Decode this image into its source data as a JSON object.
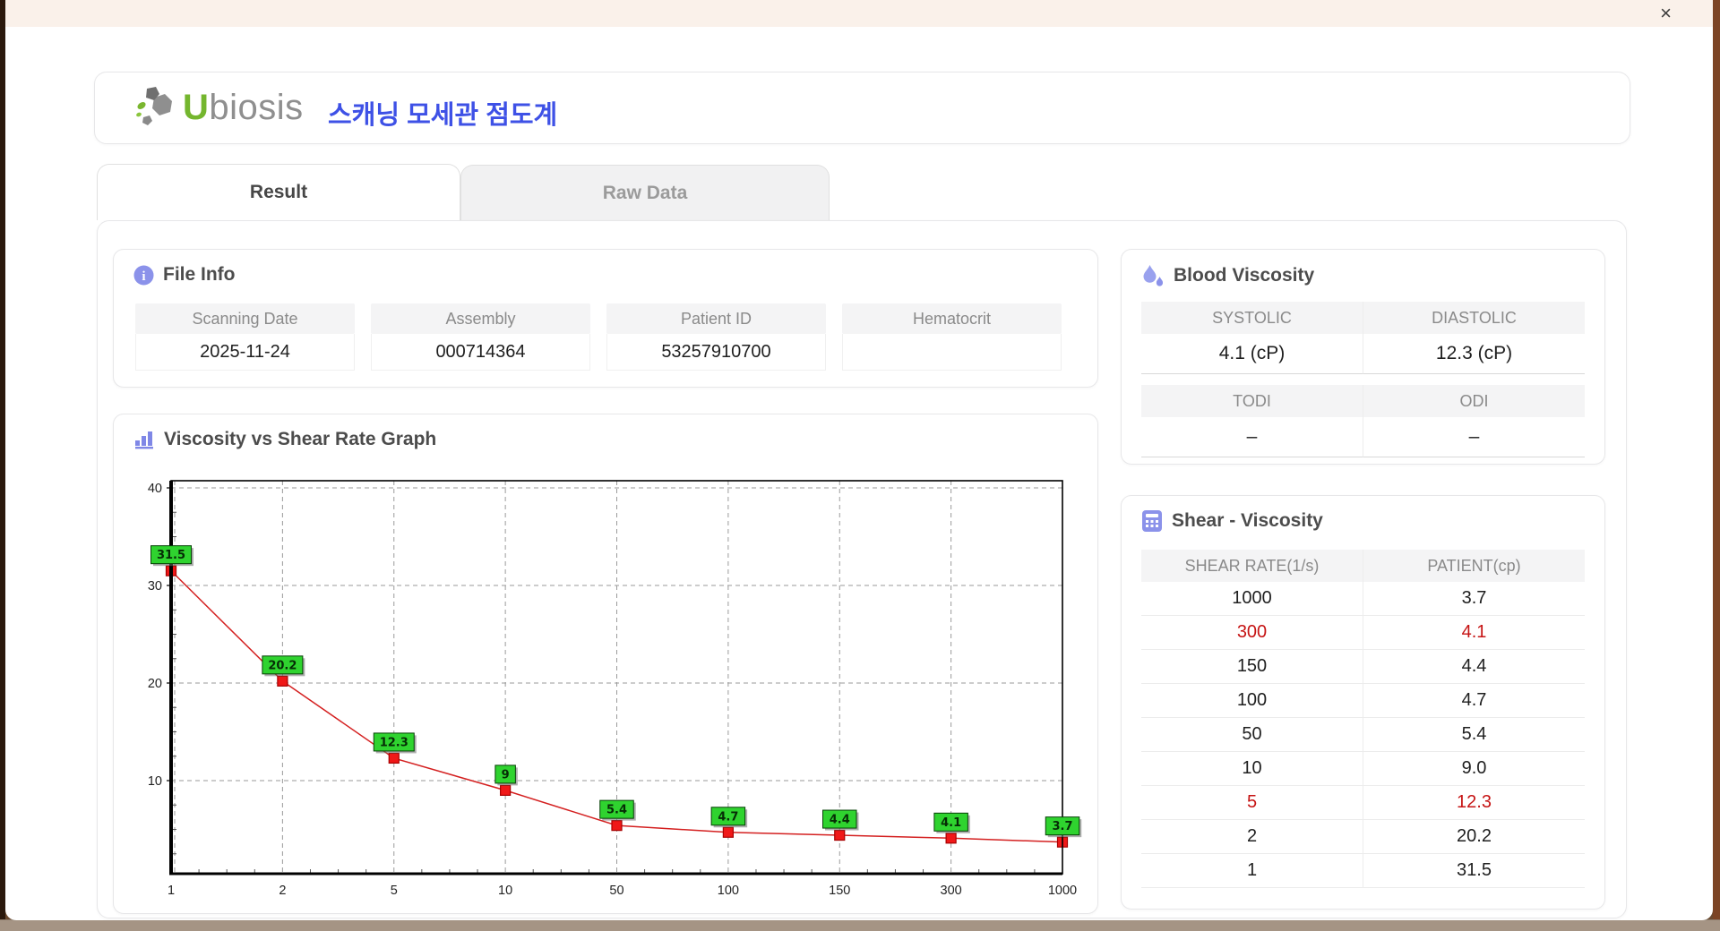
{
  "window": {
    "close_label": "×"
  },
  "header": {
    "logo_u": "U",
    "logo_rest": "biosis",
    "app_title": "스캐닝 모세관 점도계"
  },
  "tabs": {
    "result": "Result",
    "raw_data": "Raw Data"
  },
  "file_info": {
    "title": "File Info",
    "fields": [
      {
        "label": "Scanning Date",
        "value": "2025-11-24"
      },
      {
        "label": "Assembly",
        "value": "000714364"
      },
      {
        "label": "Patient ID",
        "value": "53257910700"
      },
      {
        "label": "Hematocrit",
        "value": ""
      }
    ]
  },
  "graph": {
    "title": "Viscosity vs Shear Rate Graph"
  },
  "chart_data": {
    "type": "line",
    "title": "Viscosity vs Shear Rate Graph",
    "x_categories": [
      "1",
      "2",
      "5",
      "10",
      "50",
      "100",
      "150",
      "300",
      "1000"
    ],
    "x_spacing": "equal-ordinal",
    "y_ticks": [
      10,
      20,
      30,
      40
    ],
    "ylim": [
      0.5,
      40.7
    ],
    "grid": "dashed",
    "series": [
      {
        "name": "patient-viscosity",
        "x": [
          1,
          2,
          5,
          10,
          50,
          100,
          150,
          300,
          1000
        ],
        "values": [
          31.5,
          20.2,
          12.3,
          9,
          5.4,
          4.7,
          4.4,
          4.1,
          3.7
        ],
        "point_labels": [
          "31.5",
          "20.2",
          "12.3",
          "9",
          "5.4",
          "4.7",
          "4.4",
          "4.1",
          "3.7"
        ],
        "line_color": "#d42020",
        "marker_color": "#f01818",
        "marker_border": "#a80000",
        "label_bg": "#2fd32f",
        "label_border": "#064006",
        "label_text_color": "#062c06"
      }
    ]
  },
  "blood_viscosity": {
    "title": "Blood Viscosity",
    "groups": [
      {
        "headers": [
          "SYSTOLIC",
          "DIASTOLIC"
        ],
        "values": [
          "4.1 (cP)",
          "12.3 (cP)"
        ]
      },
      {
        "headers": [
          "TODI",
          "ODI"
        ],
        "values": [
          "–",
          "–"
        ]
      }
    ]
  },
  "shear_viscosity": {
    "title": "Shear - Viscosity",
    "columns": [
      "SHEAR RATE(1/s)",
      "PATIENT(cp)"
    ],
    "rows": [
      [
        "1000",
        "3.7"
      ],
      [
        "300",
        "4.1"
      ],
      [
        "150",
        "4.4"
      ],
      [
        "100",
        "4.7"
      ],
      [
        "50",
        "5.4"
      ],
      [
        "10",
        "9.0"
      ],
      [
        "5",
        "12.3"
      ],
      [
        "2",
        "20.2"
      ],
      [
        "1",
        "31.5"
      ]
    ],
    "highlight_rows": [
      1,
      6
    ],
    "highlight_color": "#c61414"
  },
  "colors": {
    "accent_purple": "#8b92ea",
    "korean_blue": "#3e51e6",
    "logo_green": "#74b62e",
    "red_highlight": "#c61414",
    "chart_line_red": "#d42020",
    "chart_label_green": "#2fd32f",
    "titlebar_cream": "#faf1ea"
  }
}
